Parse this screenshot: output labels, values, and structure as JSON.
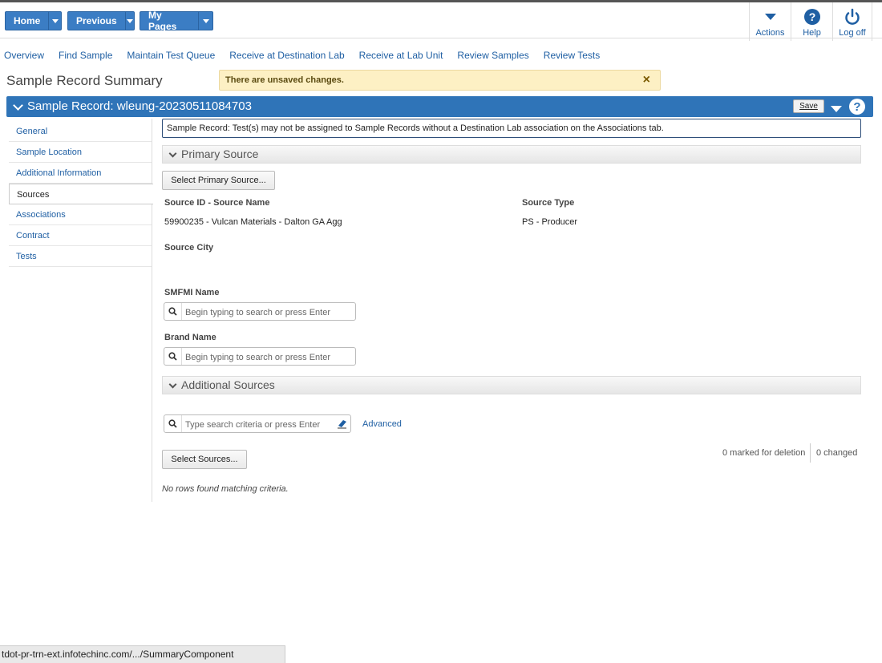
{
  "topnav": {
    "home_label": "Home",
    "previous_label": "Previous",
    "mypages_label": "My Pages",
    "actions_label": "Actions",
    "help_label": "Help",
    "logoff_label": "Log off"
  },
  "subnav": [
    "Overview",
    "Find Sample",
    "Maintain Test Queue",
    "Receive at Destination Lab",
    "Receive at Lab Unit",
    "Review Samples",
    "Review Tests"
  ],
  "page_title": "Sample Record Summary",
  "warning": {
    "text": "There are unsaved changes.",
    "close": "×"
  },
  "record_bar": {
    "title": "Sample Record: wleung-20230511084703",
    "save_label": "Save",
    "help": "?"
  },
  "sidebar": {
    "items": [
      "General",
      "Sample Location",
      "Additional Information",
      "Sources",
      "Associations",
      "Contract",
      "Tests"
    ],
    "active": "Sources"
  },
  "notice": "Sample Record: Test(s) may not be assigned to Sample Records without a Destination Lab association on the Associations tab.",
  "primary_source": {
    "header": "Primary Source",
    "select_button": "Select Primary Source...",
    "source_id_label": "Source ID - Source Name",
    "source_id_value": "59900235 - Vulcan Materials - Dalton GA Agg",
    "source_type_label": "Source Type",
    "source_type_value": "PS - Producer",
    "source_city_label": "Source City",
    "smfmi_label": "SMFMI Name",
    "smfmi_placeholder": "Begin typing to search or press Enter",
    "brand_label": "Brand Name",
    "brand_placeholder": "Begin typing to search or press Enter"
  },
  "additional_sources": {
    "header": "Additional Sources",
    "search_placeholder": "Type search criteria or press Enter",
    "advanced_label": "Advanced",
    "select_button": "Select Sources...",
    "marked_for_deletion": "0 marked for deletion",
    "changed": "0 changed",
    "empty_text": "No rows found matching criteria."
  },
  "status_bar": "tdot-pr-trn-ext.infotechinc.com/.../SummaryComponent",
  "colors": {
    "accent": "#2f74b8",
    "warning_bg": "#fdf0c4",
    "link": "#1f5fa3"
  }
}
